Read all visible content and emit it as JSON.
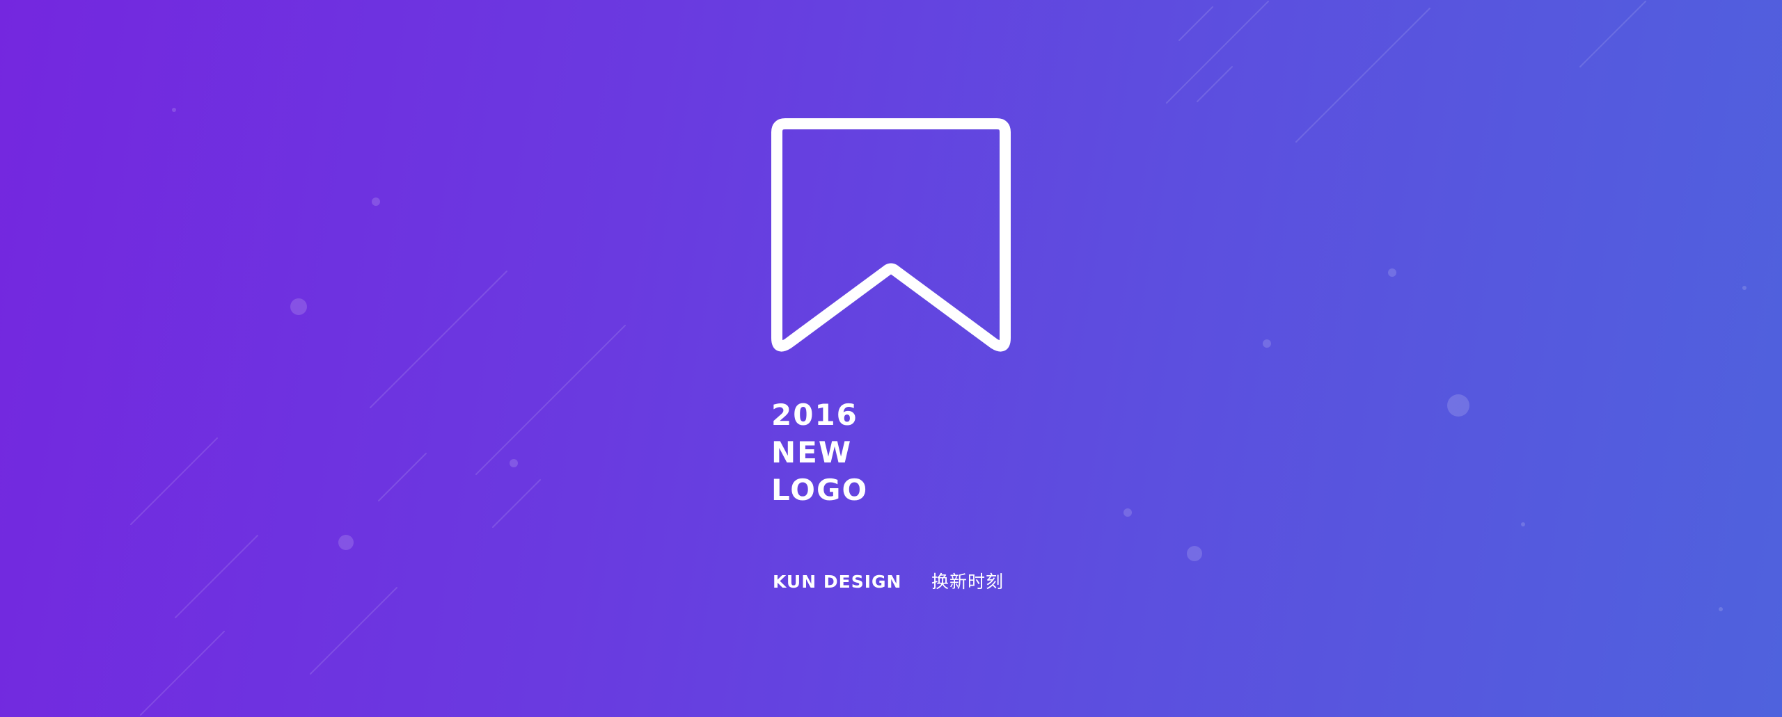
{
  "banner": {
    "headline": {
      "year": "2016",
      "line2": "NEW",
      "line3": "LOGO"
    },
    "brand_name": "KUN DESIGN",
    "tagline": "换新时刻",
    "logo_icon": "bookmark-ribbon-icon"
  },
  "colors": {
    "background_start": "#7427df",
    "background_end": "#4f62dd",
    "foreground": "#ffffff"
  }
}
